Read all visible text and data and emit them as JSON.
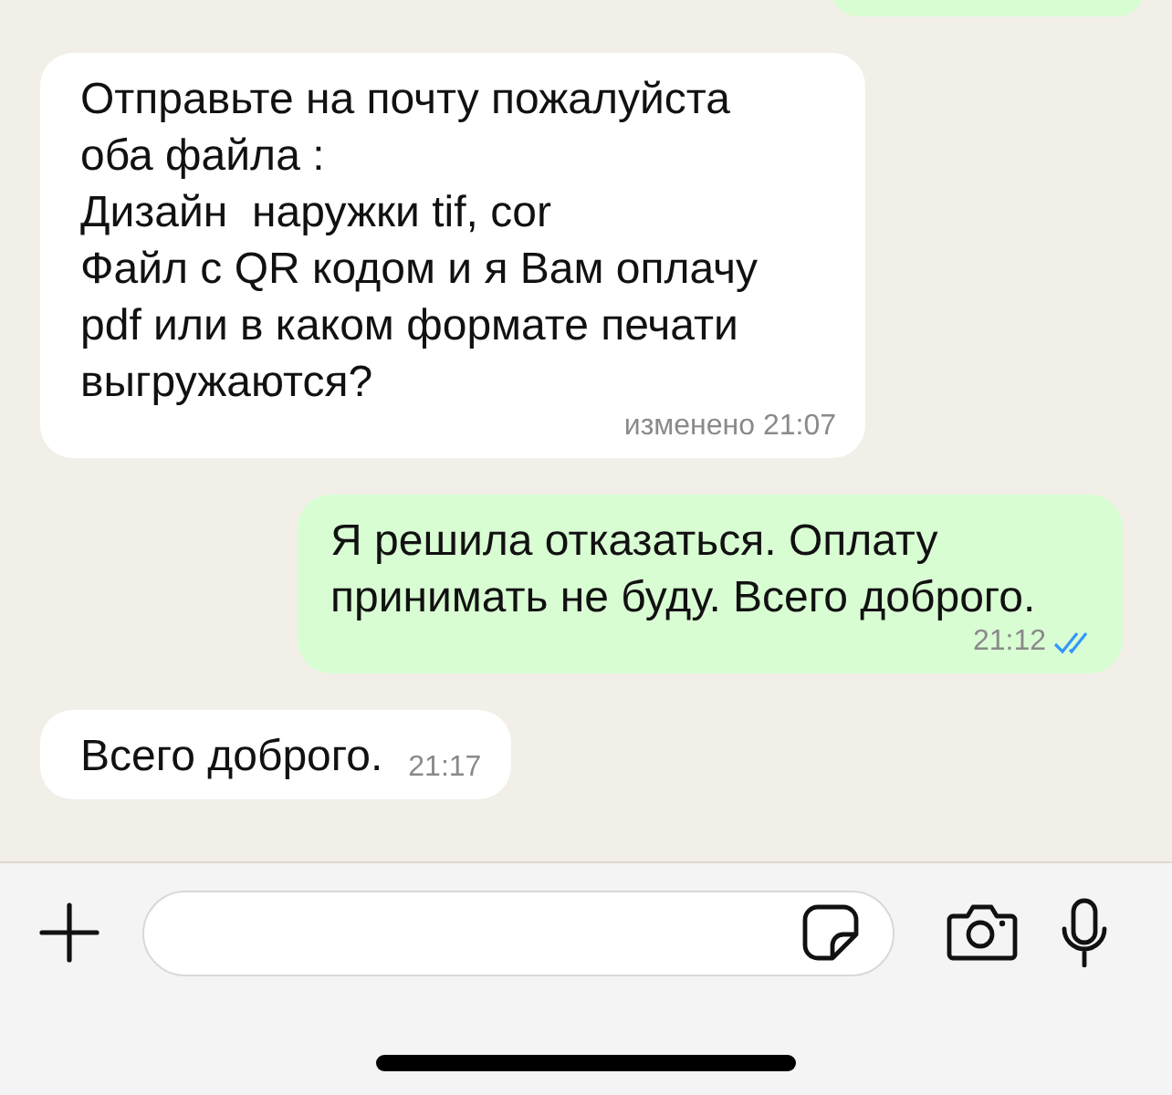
{
  "messages": [
    {
      "kind": "outgoing"
    },
    {
      "kind": "incoming",
      "lines": [
        "Отправьте на почту пожалуйста",
        "оба файла :",
        "Дизайн  наружки tif, cor",
        "Файл с QR кодом и я Вам оплачу",
        "pdf или в каком формате печати",
        "выгружаются?"
      ],
      "time": "изменено 21:07"
    },
    {
      "kind": "outgoing",
      "lines": [
        "Я решила отказаться. Оплату",
        "принимать не буду. Всего доброго."
      ],
      "time": "21:12",
      "read": true
    },
    {
      "kind": "incoming",
      "lines": [
        "Всего доброго."
      ],
      "time": "21:17"
    }
  ]
}
